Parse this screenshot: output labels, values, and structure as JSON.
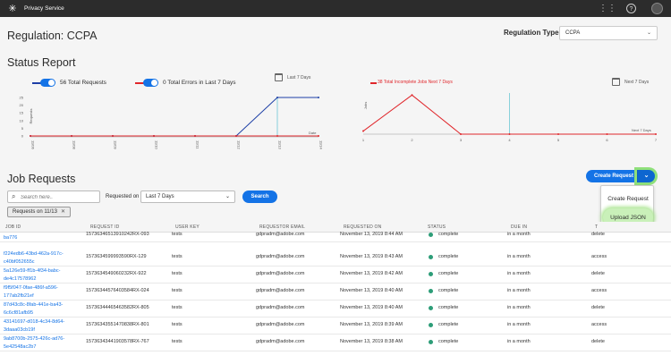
{
  "topbar": {
    "app_name": "Privacy Service",
    "icons": [
      "adobe-logo-icon",
      "app-grid-icon",
      "help-icon",
      "avatar"
    ]
  },
  "header": {
    "title": "Regulation: CCPA",
    "regulation_type_label": "Regulation Type:",
    "regulation_type_value": "CCPA"
  },
  "status": {
    "title": "Status Report",
    "left": {
      "total_requests_label": "56 Total Requests",
      "total_errors_label": "0 Total Errors in Last 7 Days",
      "period_label": "Last 7 Days",
      "y_axis_label": "Requests",
      "x_axis_label": "Date"
    },
    "right": {
      "incomplete_label": "38 Total Incomplete Jobs Next 7 Days",
      "period_label": "Next 7 Days",
      "y_axis_label": "Jobs",
      "x_axis_label": "Next 7 Days"
    }
  },
  "chart_data": [
    {
      "type": "line",
      "x": [
        "11/06",
        "11/08",
        "11/09",
        "11/10",
        "11/11",
        "11/12",
        "11/13",
        "11/14"
      ],
      "series": [
        {
          "values": [
            0,
            0,
            0,
            0,
            0,
            0,
            28,
            28
          ],
          "color": "#1d3fa6"
        },
        {
          "values": [
            0,
            0,
            0,
            0,
            0,
            0,
            0,
            0
          ],
          "color": "#e0262b"
        }
      ],
      "ylim": [
        0,
        25
      ],
      "yticks": [
        0,
        5,
        10,
        15,
        20,
        25
      ],
      "ylabel": "Requests",
      "xlabel": "Date"
    },
    {
      "type": "line",
      "x": [
        1,
        2,
        3,
        4,
        5,
        6,
        7
      ],
      "series": [
        {
          "values": [
            3,
            38,
            0,
            0,
            0,
            0,
            0
          ],
          "color": "#e0262b"
        }
      ],
      "ylim": [
        0,
        40
      ],
      "ylabel": "Jobs",
      "xlabel": "Next 7 Days"
    }
  ],
  "jobs": {
    "title": "Job Requests",
    "search_placeholder": "Search here..",
    "requested_on_label": "Requested on",
    "date_filter": "Last 7 Days",
    "search_button": "Search",
    "chip": "Requests on 11/13",
    "create_button": "Create Request",
    "dropdown_items": [
      "Create Request",
      "Upload JSON"
    ],
    "columns": [
      "JOB ID",
      "REQUEST ID",
      "USER KEY",
      "REQUESTOR EMAIL",
      "REQUESTED ON",
      "STATUS",
      "DUE IN",
      "T"
    ],
    "rows": [
      {
        "job_id": "ba776",
        "request_id": "1573634651391024​2RX-093",
        "user_key": "tests",
        "email": "gdpradm@adobe.com",
        "requested_on": "November 13, 2019 8:44 AM",
        "status": "complete",
        "due_in": "in a month",
        "type": "delete"
      },
      {
        "job_id": "f224edb6-43bd-462a-917c-c40bf052655c",
        "request_id": "1573634599993590RX-129",
        "user_key": "tests",
        "email": "gdpradm@adobe.com",
        "requested_on": "November 13, 2019 8:43 AM",
        "status": "complete",
        "due_in": "in a month",
        "type": "access"
      },
      {
        "job_id": "5a126e59-ff1b-4f34-babc-de4c17578962",
        "request_id": "1573634549060232RX-922",
        "user_key": "tests",
        "email": "gdpradm@adobe.com",
        "requested_on": "November 13, 2019 8:42 AM",
        "status": "complete",
        "due_in": "in a month",
        "type": "delete"
      },
      {
        "job_id": "f9f5f047-0fae-486f-a596-177ab2fb21ef",
        "request_id": "1573634457640358​4RX-024",
        "user_key": "tests",
        "email": "gdpradm@adobe.com",
        "requested_on": "November 13, 2019 8:40 AM",
        "status": "complete",
        "due_in": "in a month",
        "type": "access"
      },
      {
        "job_id": "87d43c8c-8fab-441e-ba43-6c6cf81afb95",
        "request_id": "1573634446546358​2RX-805",
        "user_key": "tests",
        "email": "gdpradm@adobe.com",
        "requested_on": "November 13, 2019 8:40 AM",
        "status": "complete",
        "due_in": "in a month",
        "type": "delete"
      },
      {
        "job_id": "43141697-d018-4c34-8d64-3daaa03cb19f",
        "request_id": "1573634355147083​8RX-801",
        "user_key": "tests",
        "email": "gdpradm@adobe.com",
        "requested_on": "November 13, 2019 8:39 AM",
        "status": "complete",
        "due_in": "in a month",
        "type": "access"
      },
      {
        "job_id": "9ab8700b-2575-426c-ad76-5e42548ac2b7",
        "request_id": "1573634344190357​8RX-767",
        "user_key": "tests",
        "email": "gdpradm@adobe.com",
        "requested_on": "November 13, 2019 8:38 AM",
        "status": "complete",
        "due_in": "in a month",
        "type": "delete"
      }
    ]
  },
  "colors": {
    "accent": "#1473e6",
    "blue_series": "#1d3fa6",
    "red_series": "#e0262b",
    "status_complete": "#2d9d78",
    "highlight": "#8fe07a"
  }
}
